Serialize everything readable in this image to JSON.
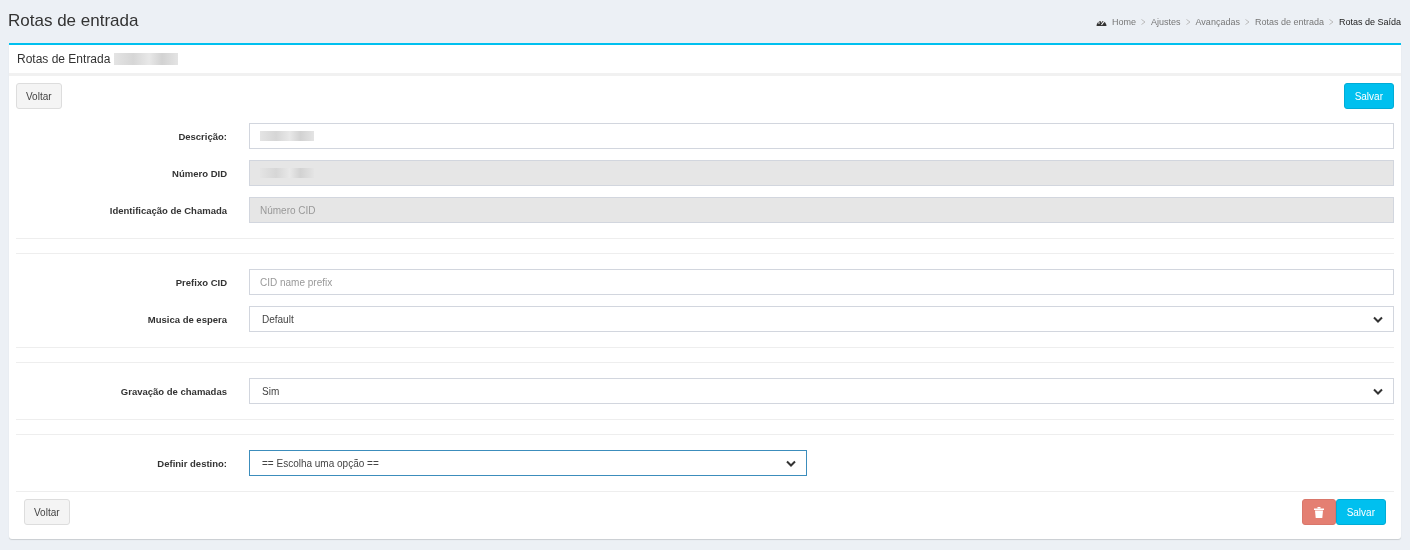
{
  "page_title": "Rotas de entrada",
  "breadcrumb": [
    {
      "label": "Home",
      "kind": "home",
      "current": false
    },
    {
      "label": "Ajustes",
      "kind": "link",
      "current": false
    },
    {
      "label": "Avançadas",
      "kind": "link",
      "current": false
    },
    {
      "label": "Rotas de entrada",
      "kind": "link",
      "current": false
    },
    {
      "label": "Rotas de Saída",
      "kind": "link",
      "current": true
    }
  ],
  "card": {
    "title": "Rotas de Entrada",
    "top_actions": [
      {
        "kind": "default",
        "label": "Voltar"
      },
      {
        "kind": "primary",
        "label": "Salvar"
      }
    ],
    "sections": [
      [
        {
          "label": "Descrição:",
          "kind": "redacted",
          "disabled": false,
          "focused": false
        },
        {
          "label": "Número DID",
          "kind": "redacted",
          "disabled": true,
          "focused": false
        },
        {
          "label": "Identificação de Chamada",
          "kind": "text",
          "placeholder": "Número CID",
          "disabled": true,
          "focused": false
        }
      ],
      [
        {
          "label": "Prefixo CID",
          "kind": "text",
          "placeholder": "CID name prefix",
          "disabled": false,
          "focused": false
        },
        {
          "label": "Musica de espera",
          "kind": "select",
          "value": "Default",
          "disabled": false,
          "focused": false
        }
      ],
      [
        {
          "label": "Gravação de chamadas",
          "kind": "select",
          "value": "Sim",
          "disabled": false,
          "focused": false
        }
      ],
      [
        {
          "label": "Definir destino:",
          "kind": "select",
          "value": "== Escolha uma opção ==",
          "disabled": false,
          "focused": true,
          "compact": true
        }
      ]
    ],
    "bottom_actions": [
      {
        "kind": "default",
        "label": "Voltar"
      },
      {
        "kind": "danger"
      },
      {
        "kind": "primary",
        "label": "Salvar"
      }
    ]
  }
}
